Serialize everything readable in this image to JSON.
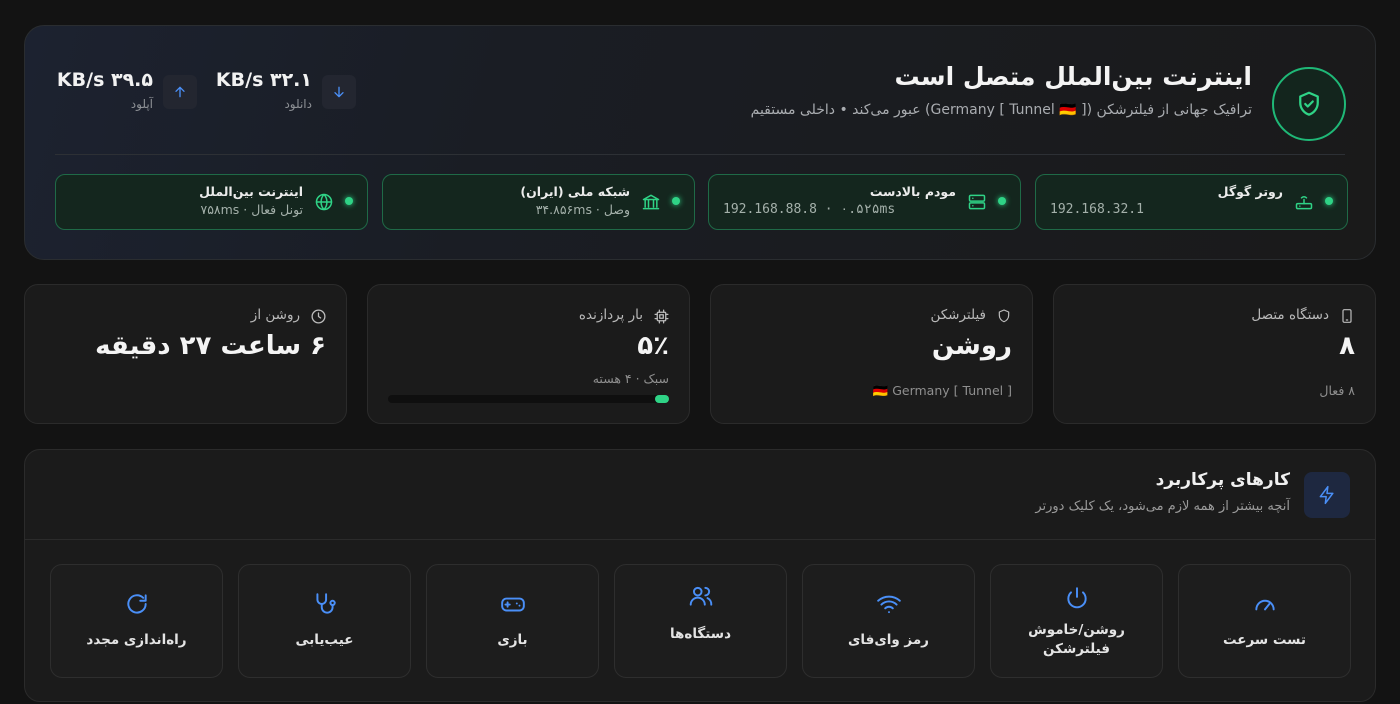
{
  "status": {
    "title": "اینترنت بین‌الملل متصل است",
    "subtitle": "ترافیک جهانی از فیلترشکن ([ Germany [ Tunnel 🇩🇪) عبور می‌کند • داخلی مستقیم",
    "shield_icon": "shield-check-icon",
    "accent": "#1fb877"
  },
  "speeds": {
    "download": {
      "value": "KB/s ۳۲.۱",
      "label": "دانلود",
      "icon": "arrow-down-icon"
    },
    "upload": {
      "value": "KB/s ۳۹.۵",
      "label": "آپلود",
      "icon": "arrow-up-icon"
    }
  },
  "connections": [
    {
      "name": "روتر گوگل",
      "meta": "192.168.32.1",
      "icon": "router-icon"
    },
    {
      "name": "مودم بالادست",
      "meta": "192.168.88.8 · ۰.۵۲۵ms",
      "icon": "server-icon"
    },
    {
      "name": "شبکه ملی (ایران)",
      "meta": "وصل · ۳۴.۸۵۶ms",
      "icon": "bank-icon"
    },
    {
      "name": "اینترنت بین‌الملل",
      "meta": "تونل فعال · ۷۵۸ms",
      "icon": "globe-icon"
    }
  ],
  "stats": {
    "devices": {
      "label": "دستگاه متصل",
      "value": "۸",
      "sub": "۸ فعال",
      "icon": "phone-icon"
    },
    "vpn": {
      "label": "فیلترشکن",
      "value": "روشن",
      "sub": "🇩🇪 Germany [ Tunnel ]",
      "icon": "shield-icon"
    },
    "cpu": {
      "label": "بار پردازنده",
      "value": "۵٪",
      "sub": "سبک · ۴ هسته",
      "icon": "cpu-icon",
      "load_fraction": 0.05
    },
    "uptime": {
      "label": "روشن از",
      "value": "۶ ساعت ۲۷ دقیقه",
      "icon": "clock-icon"
    }
  },
  "quick_actions": {
    "title": "کارهای پرکاربرد",
    "subtitle": "آنچه بیشتر از همه لازم می‌شود، یک کلیک دورتر",
    "icon": "bolt-icon",
    "items": [
      {
        "label": "تست سرعت",
        "icon": "speedometer-icon"
      },
      {
        "label": "روشن/خاموش فیلترشکن",
        "icon": "power-icon"
      },
      {
        "label": "رمز وای‌فای",
        "icon": "wifi-icon"
      },
      {
        "label": "دستگاه‌ها",
        "icon": "users-icon"
      },
      {
        "label": "بازی",
        "icon": "gamepad-icon"
      },
      {
        "label": "عیب‌یابی",
        "icon": "stethoscope-icon"
      },
      {
        "label": "راه‌اندازی مجدد",
        "icon": "refresh-icon"
      }
    ]
  },
  "colors": {
    "background": "#131313",
    "card": "#1b1b1b",
    "green": "#2fd386",
    "blue": "#3b82f6"
  }
}
